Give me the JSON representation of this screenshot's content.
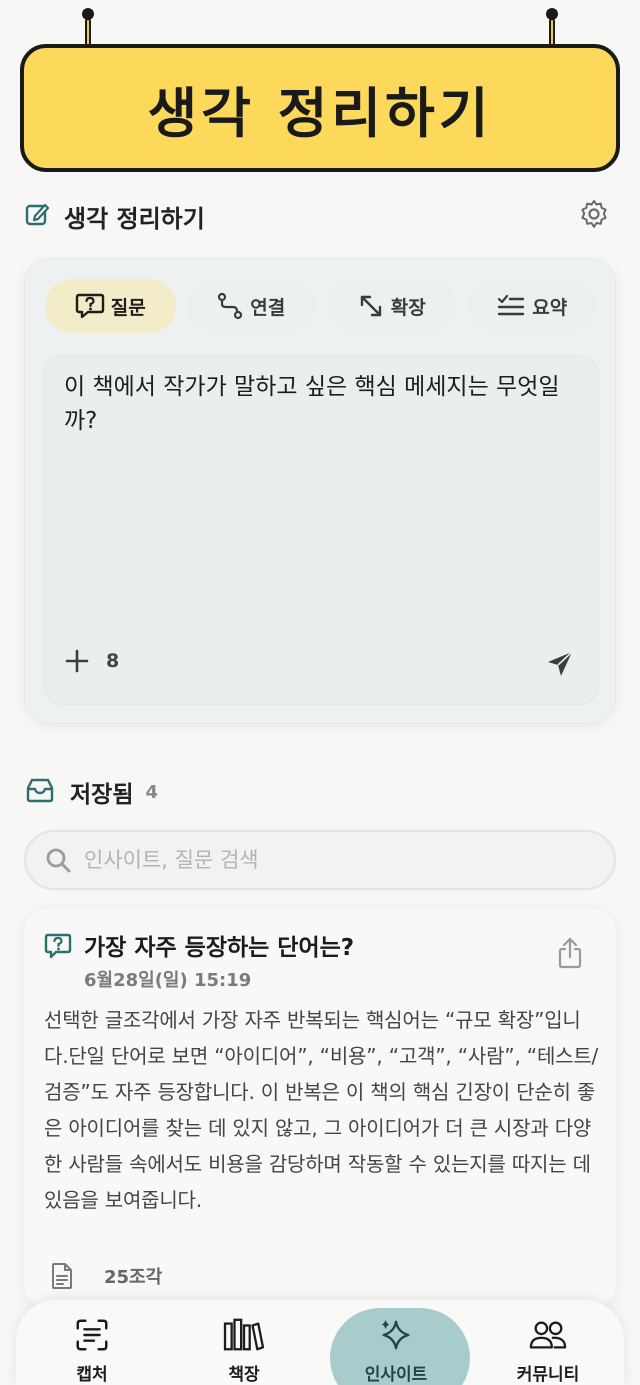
{
  "banner": {
    "title": "생각 정리하기"
  },
  "header": {
    "title": "생각 정리하기"
  },
  "composer": {
    "tabs": [
      {
        "label": "질문",
        "icon": "question-icon",
        "active": true
      },
      {
        "label": "연결",
        "icon": "connect-icon",
        "active": false
      },
      {
        "label": "확장",
        "icon": "expand-icon",
        "active": false
      },
      {
        "label": "요약",
        "icon": "summary-icon",
        "active": false
      }
    ],
    "question": "이 책에서 작가가 말하고 싶은 핵심 메세지는 무엇일까?",
    "add_count": "8"
  },
  "saved": {
    "title": "저장됨",
    "count": "4",
    "search_placeholder": "인사이트, 질문 검색"
  },
  "insight": {
    "title": "가장 자주 등장하는 단어는?",
    "date": "6월28일(일) 15:19",
    "body": "선택한 글조각에서 가장 자주 반복되는 핵심어는 “규모 확장”입니다.단일 단어로 보면 “아이디어”, “비용”, “고객”, “사람”, “테스트/검증”도 자주 등장합니다. 이 반복은 이 책의 핵심 긴장이 단순히 좋은 아이디어를 찾는 데 있지 않고, 그 아이디어가 더 큰 시장과 다양한 사람들 속에서도 비용을 감당하며 작동할 수 있는지를 따지는 데 있음을 보여줍니다.",
    "fragments": "25조각"
  },
  "nav": {
    "items": [
      {
        "label": "캡처",
        "icon": "capture-icon",
        "active": false
      },
      {
        "label": "책장",
        "icon": "bookshelf-icon",
        "active": false
      },
      {
        "label": "인사이트",
        "icon": "sparkle-icon",
        "active": true
      },
      {
        "label": "커뮤니티",
        "icon": "community-icon",
        "active": false
      }
    ]
  },
  "colors": {
    "banner": "#fcd95a",
    "accent_teal": "#2f6e6c",
    "active_tab": "#f3ecc9",
    "nav_active": "#a8cccc"
  }
}
